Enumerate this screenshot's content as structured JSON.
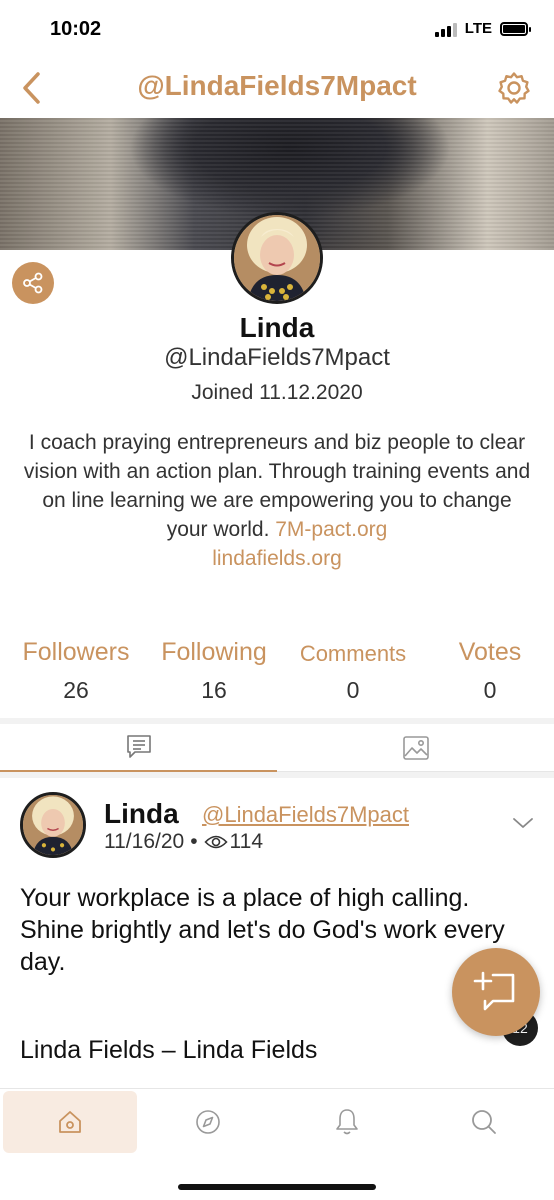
{
  "status_bar": {
    "time": "10:02",
    "network": "LTE"
  },
  "header": {
    "title": "@LindaFields7Mpact",
    "back_icon": "chevron-left-icon",
    "settings_icon": "gear-icon"
  },
  "profile": {
    "name": "Linda",
    "handle": "@LindaFields7Mpact",
    "joined": "Joined 11.12.2020",
    "bio_text": "I coach praying entrepreneurs and biz people to clear vision with an action plan. Through training events and on line learning we are empowering you to change your world.",
    "bio_link_1": "7M-pact.org",
    "bio_link_2": "lindafields.org",
    "share_icon": "share-icon"
  },
  "stats": [
    {
      "label": "Followers",
      "value": "26"
    },
    {
      "label": "Following",
      "value": "16"
    },
    {
      "label": "Comments",
      "value": "0"
    },
    {
      "label": "Votes",
      "value": "0"
    }
  ],
  "tabs": [
    {
      "icon": "posts-icon",
      "active": true
    },
    {
      "icon": "image-icon",
      "active": false
    }
  ],
  "post": {
    "author": "Linda",
    "handle": "@LindaFields7Mpact",
    "date": "11/16/20",
    "separator": "•",
    "views": "114",
    "body": "Your workplace is a place of high calling. Shine brightly and let's do God's work every day.",
    "footer": "Linda Fields – Linda Fields",
    "reply_count": "12"
  },
  "fab_icon": "compose-icon",
  "bottom_nav": [
    {
      "icon": "home-icon",
      "active": true
    },
    {
      "icon": "compass-icon",
      "active": false
    },
    {
      "icon": "bell-icon",
      "active": false
    },
    {
      "icon": "search-icon",
      "active": false
    }
  ],
  "colors": {
    "accent": "#c9935f",
    "active_nav_bg": "#f8ebe1"
  }
}
